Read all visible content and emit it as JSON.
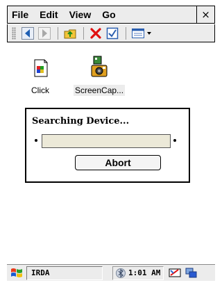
{
  "menu": {
    "items": [
      "File",
      "Edit",
      "View",
      "Go"
    ],
    "close_label": "×"
  },
  "toolbar": {
    "buttons": [
      "back-icon",
      "forward-icon",
      "up-folder-icon",
      "delete-icon",
      "properties-icon",
      "view-mode-icon"
    ]
  },
  "desktop": {
    "icons": [
      {
        "label": "Click",
        "icon": "click-app-icon",
        "selected": false
      },
      {
        "label": "ScreenCap...",
        "icon": "screencap-app-icon",
        "selected": true
      }
    ]
  },
  "dialog": {
    "title": "Searching Device...",
    "progress": 0,
    "abort_label": "Abort"
  },
  "taskbar": {
    "task_label": "IRDA",
    "clock": "1:01 AM",
    "tray_icons": [
      "bluetooth-icon",
      "sync-icon",
      "input-panel-icon"
    ]
  }
}
